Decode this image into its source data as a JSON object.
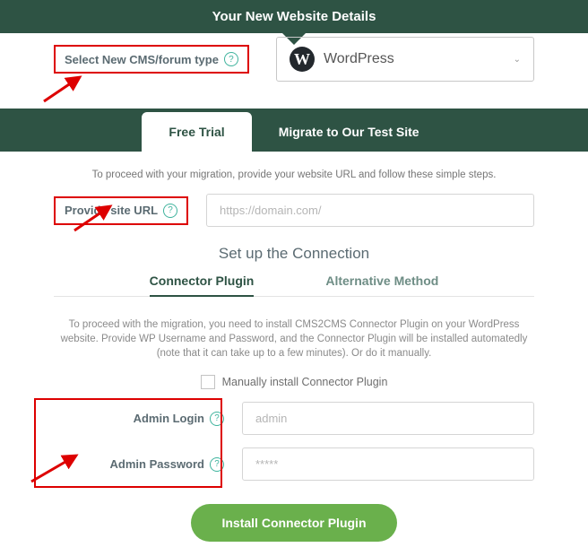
{
  "header": {
    "title": "Your New Website Details"
  },
  "cms": {
    "label": "Select New CMS/forum type",
    "selected": "WordPress"
  },
  "tabs": {
    "free_trial": "Free Trial",
    "migrate": "Migrate to Our Test Site"
  },
  "intro": "To proceed with your migration, provide your website URL and follow these simple steps.",
  "url": {
    "label": "Provide site URL",
    "placeholder": "https://domain.com/"
  },
  "section_title": "Set up the Connection",
  "methods": {
    "connector": "Connector Plugin",
    "alternative": "Alternative Method"
  },
  "desc": "To proceed with the migration, you need to install CMS2CMS Connector Plugin on your WordPress website. Provide WP Username and Password, and the Connector Plugin will be installed automatedly (note that it can take up to a few minutes). Or do it manually.",
  "manual_check": "Manually install Connector Plugin",
  "creds": {
    "login_label": "Admin Login",
    "login_placeholder": "admin",
    "password_label": "Admin Password",
    "password_placeholder": "*****"
  },
  "install_btn": "Install Connector Plugin"
}
